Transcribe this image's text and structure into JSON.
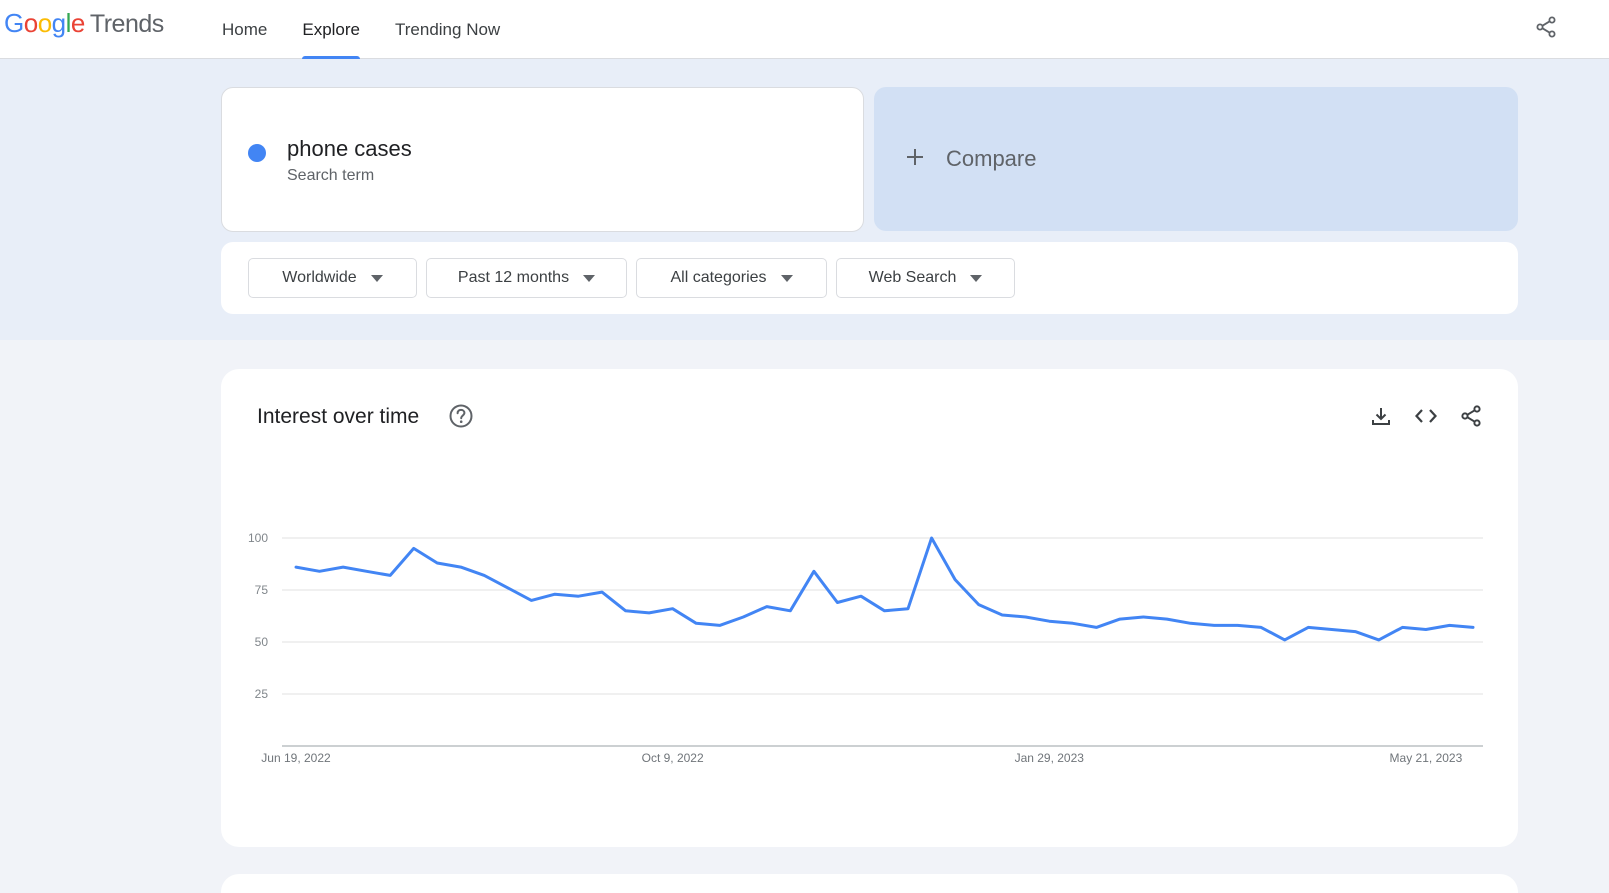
{
  "header": {
    "logo_google": [
      "G",
      "o",
      "o",
      "g",
      "l",
      "e"
    ],
    "logo_product": "Trends",
    "nav": [
      {
        "label": "Home",
        "active": false
      },
      {
        "label": "Explore",
        "active": true
      },
      {
        "label": "Trending Now",
        "active": false
      }
    ],
    "share_icon": "share-icon"
  },
  "search": {
    "term": "phone cases",
    "term_type": "Search term",
    "term_color": "#4285f4",
    "compare_label": "Compare"
  },
  "filters": [
    {
      "label": "Worldwide"
    },
    {
      "label": "Past 12 months"
    },
    {
      "label": "All categories"
    },
    {
      "label": "Web Search"
    }
  ],
  "chart_card": {
    "title": "Interest over time",
    "actions": [
      "download-icon",
      "embed-code-icon",
      "share-icon"
    ]
  },
  "chart_data": {
    "type": "line",
    "title": "Interest over time",
    "xlabel": "",
    "ylabel": "",
    "ylim": [
      0,
      100
    ],
    "yticks": [
      25,
      50,
      75,
      100
    ],
    "grid": true,
    "x_tick_labels": [
      {
        "label": "Jun 19, 2022",
        "index": 0
      },
      {
        "label": "Oct 9, 2022",
        "index": 16
      },
      {
        "label": "Jan 29, 2023",
        "index": 32
      },
      {
        "label": "May 21, 2023",
        "index": 48
      }
    ],
    "series": [
      {
        "color": "#4285f4",
        "values": [
          86,
          84,
          86,
          84,
          82,
          95,
          88,
          86,
          82,
          76,
          70,
          73,
          72,
          74,
          65,
          64,
          66,
          59,
          58,
          62,
          67,
          65,
          84,
          69,
          72,
          65,
          66,
          100,
          80,
          68,
          63,
          62,
          60,
          59,
          57,
          61,
          62,
          61,
          59,
          58,
          58,
          57,
          51,
          57,
          56,
          55,
          51,
          57,
          56,
          58,
          57
        ]
      }
    ]
  }
}
